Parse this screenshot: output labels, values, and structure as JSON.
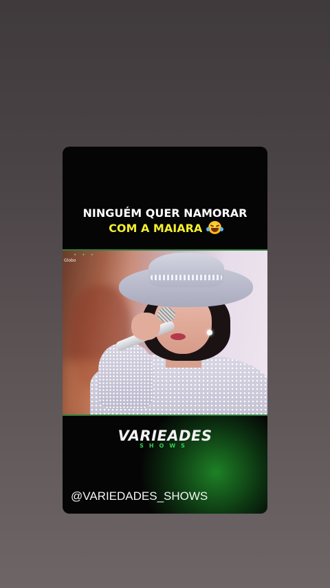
{
  "post": {
    "headline_line1": "NINGUÉM QUER NAMORAR",
    "headline_line2": "COM A MAIARA",
    "emoji_icon": "face-with-tears-of-joy-icon",
    "video": {
      "watermark": "Globo",
      "hud": "+ + +"
    },
    "brand_main": "VARIEADES",
    "brand_sub": "SHOWS",
    "handle": "@VARIEDADES_SHOWS"
  },
  "colors": {
    "headline_accent": "#f3ef2e",
    "brand_green": "#2fd14f",
    "card_background": "#050505"
  }
}
